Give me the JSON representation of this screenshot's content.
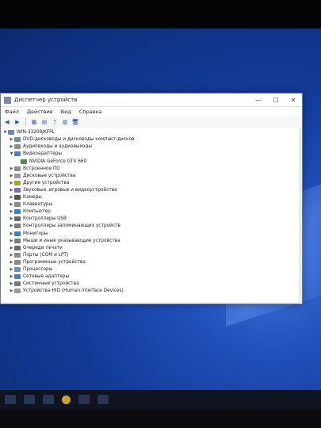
{
  "window": {
    "title": "Диспетчер устройств",
    "minimize": "—",
    "maximize": "☐",
    "close": "✕"
  },
  "menu": [
    "Файл",
    "Действие",
    "Вид",
    "Справка"
  ],
  "tree": {
    "root": "WIN-33208JKFPL",
    "items": [
      {
        "label": "DVD-дисководы и дисководы компакт-дисков",
        "depth": 1,
        "expanded": false,
        "icon": "dvd-icon"
      },
      {
        "label": "Аудиовходы и аудиовыходы",
        "depth": 1,
        "expanded": false,
        "icon": "audio-icon"
      },
      {
        "label": "Видеоадаптеры",
        "depth": 1,
        "expanded": true,
        "icon": "display-adapter-icon"
      },
      {
        "label": "NVIDIA GeForce GTX 660",
        "depth": 2,
        "expanded": null,
        "icon": "gpu-icon"
      },
      {
        "label": "Встроенное ПО",
        "depth": 1,
        "expanded": false,
        "icon": "firmware-icon"
      },
      {
        "label": "Дисковые устройства",
        "depth": 1,
        "expanded": false,
        "icon": "disk-icon"
      },
      {
        "label": "Другие устройства",
        "depth": 1,
        "expanded": false,
        "icon": "unknown-device-icon"
      },
      {
        "label": "Звуковые, игровые и видеоустройства",
        "depth": 1,
        "expanded": false,
        "icon": "sound-icon"
      },
      {
        "label": "Камеры",
        "depth": 1,
        "expanded": false,
        "icon": "camera-icon"
      },
      {
        "label": "Клавиатуры",
        "depth": 1,
        "expanded": false,
        "icon": "keyboard-icon"
      },
      {
        "label": "Компьютер",
        "depth": 1,
        "expanded": false,
        "icon": "computer-icon"
      },
      {
        "label": "Контроллеры USB",
        "depth": 1,
        "expanded": false,
        "icon": "usb-icon"
      },
      {
        "label": "Контроллеры запоминающих устройств",
        "depth": 1,
        "expanded": false,
        "icon": "storage-controller-icon"
      },
      {
        "label": "Мониторы",
        "depth": 1,
        "expanded": false,
        "icon": "monitor-icon"
      },
      {
        "label": "Мыши и иные указывающие устройства",
        "depth": 1,
        "expanded": false,
        "icon": "mouse-icon"
      },
      {
        "label": "Очереди печати",
        "depth": 1,
        "expanded": false,
        "icon": "printer-icon"
      },
      {
        "label": "Порты (COM и LPT)",
        "depth": 1,
        "expanded": false,
        "icon": "port-icon"
      },
      {
        "label": "Программные устройства",
        "depth": 1,
        "expanded": false,
        "icon": "software-device-icon"
      },
      {
        "label": "Процессоры",
        "depth": 1,
        "expanded": false,
        "icon": "cpu-icon"
      },
      {
        "label": "Сетевые адаптеры",
        "depth": 1,
        "expanded": false,
        "icon": "network-icon"
      },
      {
        "label": "Системные устройства",
        "depth": 1,
        "expanded": false,
        "icon": "system-device-icon"
      },
      {
        "label": "Устройства HID (Human Interface Devices)",
        "depth": 1,
        "expanded": false,
        "icon": "hid-icon"
      }
    ]
  },
  "colors": {
    "selection": "#cde4f7",
    "desktop": "#1f4fb8"
  }
}
